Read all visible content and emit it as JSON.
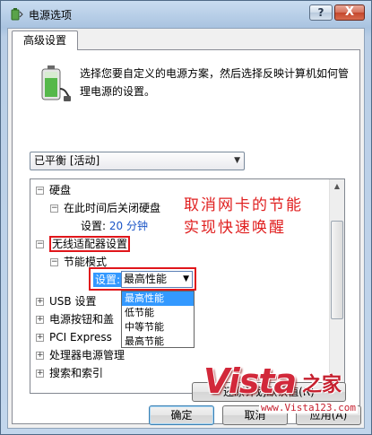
{
  "window": {
    "title": "电源选项"
  },
  "tabs": [
    {
      "label": "高级设置"
    }
  ],
  "intro_text": "选择您要自定义的电源方案，然后选择反映计算机如何管理电源的设置。",
  "plan_select": {
    "value": "已平衡 [活动]"
  },
  "tree": {
    "hard_disk": "硬盘",
    "disk_off_after": "在此时间后关闭硬盘",
    "disk_setting_label": "设置:",
    "disk_setting_value": "20 分钟",
    "wireless": "无线适配器设置",
    "power_saving_mode": "节能模式",
    "setting_label": "设置:",
    "setting_value": "最高性能",
    "usb": "USB 设置",
    "power_buttons": "电源按钮和盖",
    "pci_express": "PCI Express",
    "processor": "处理器电源管理",
    "search_index": "搜索和索引"
  },
  "dropdown_options": [
    "最高性能",
    "低节能",
    "中等节能",
    "最高节能"
  ],
  "annotation": {
    "line1": "取消网卡的节能",
    "line2": "实现快速唤醒"
  },
  "buttons": {
    "restore": "还原计划默认值(R)",
    "ok": "确定",
    "cancel": "取消",
    "apply": "应用(A)"
  },
  "watermark": {
    "logo": "Vista",
    "cn": "之家",
    "url": "www.Vista123.com"
  },
  "icons": {
    "help": "?",
    "close": "X"
  }
}
